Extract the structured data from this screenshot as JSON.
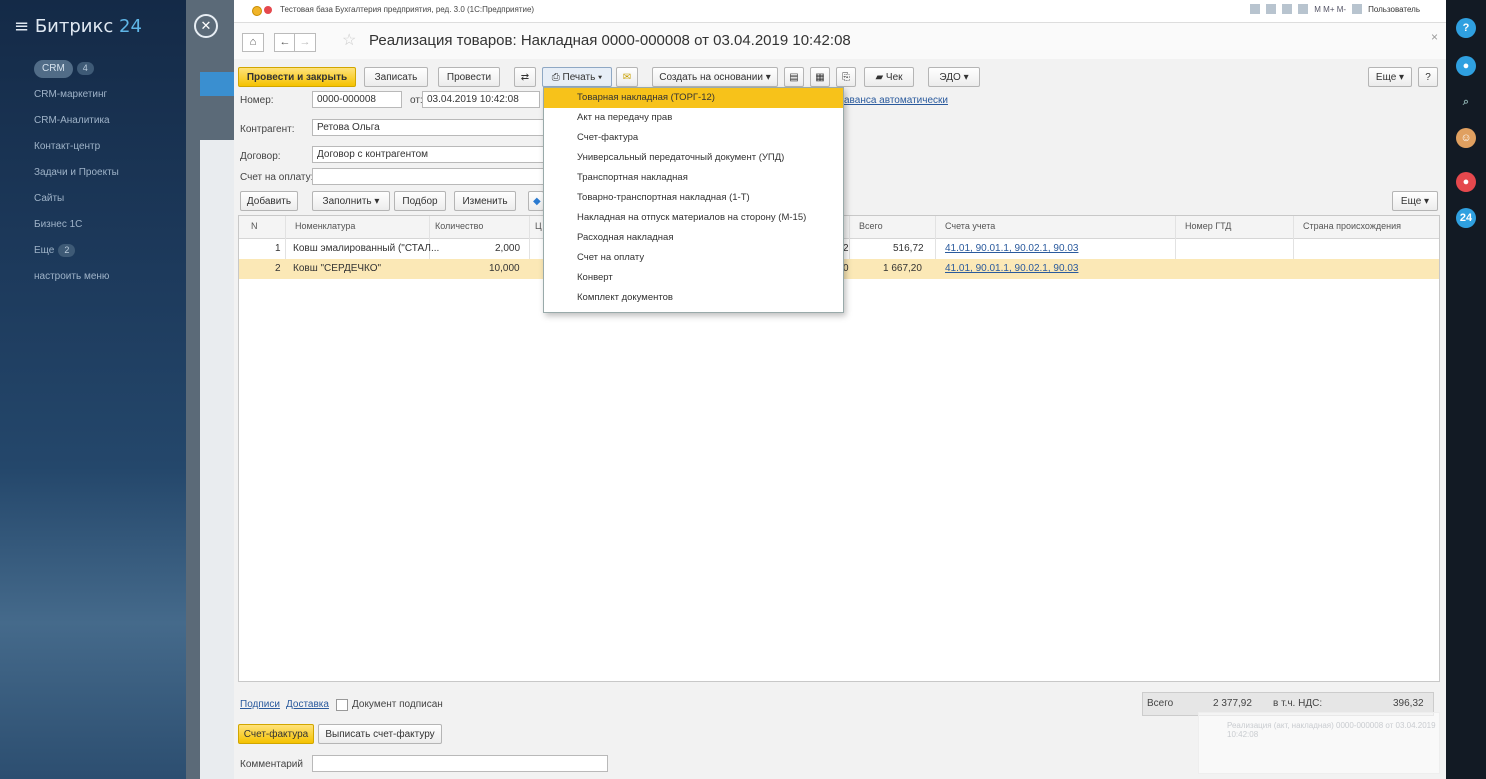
{
  "bitrix": {
    "logo_prefix": "Битрикс",
    "logo_num": "24",
    "nav": [
      {
        "label": "CRM",
        "badge": "4"
      },
      {
        "label": "CRM-маркетинг"
      },
      {
        "label": "CRM-Аналитика"
      },
      {
        "label": "Контакт-центр"
      },
      {
        "label": "Задачи и Проекты"
      },
      {
        "label": "Сайты"
      },
      {
        "label": "Бизнес 1С"
      },
      {
        "label": "Еще",
        "badge": "2"
      },
      {
        "label": "настроить меню"
      }
    ],
    "right_badges": [
      "?",
      "24"
    ]
  },
  "window": {
    "app_title": "Тестовая база Бухгалтерия предприятия, ред. 3.0  (1С:Предприятие)",
    "tools_user": "Пользователь",
    "doc_title": "Реализация товаров: Накладная 0000-000008 от 03.04.2019 10:42:08"
  },
  "toolbar": {
    "post_close": "Провести и закрыть",
    "save": "Записать",
    "post": "Провести",
    "print": "Печать",
    "create_based": "Создать на основании",
    "check": "Чек",
    "edo": "ЭДО",
    "more": "Еще",
    "help": "?"
  },
  "form": {
    "number_label": "Номер:",
    "number_value": "0000-000008",
    "date_label": "от:",
    "date_value": "03.04.2019 10:42:08",
    "counterparty_label": "Контрагент:",
    "counterparty_value": "Ретова Ольга",
    "contract_label": "Договор:",
    "contract_value": "Договор с контрагентом",
    "invoice_label": "Счет на оплату:",
    "advance_link": "аванса автоматически"
  },
  "table_toolbar": {
    "add": "Добавить",
    "fill": "Заполнить",
    "select": "Подбор",
    "change": "Изменить",
    "more": "Еще"
  },
  "table": {
    "headers": [
      "N",
      "Номенклатура",
      "Количество",
      "Ц",
      "Всего",
      "Счета учета",
      "Номер ГТД",
      "Страна происхождения"
    ],
    "rows": [
      {
        "n": "1",
        "name": "Ковш эмалированный (\"СТАЛ...",
        "qty": "2,000",
        "price_tail": "2",
        "total": "516,72",
        "accounts": "41.01, 90.01.1, 90.02.1, 90.03"
      },
      {
        "n": "2",
        "name": "Ковш \"СЕРДЕЧКО\"",
        "qty": "10,000",
        "price_tail": "0",
        "total": "1 667,20",
        "accounts": "41.01, 90.01.1, 90.02.1, 90.03"
      }
    ]
  },
  "print_menu": {
    "items": [
      "Товарная накладная (ТОРГ-12)",
      "Акт на передачу прав",
      "Счет-фактура",
      "Универсальный передаточный документ (УПД)",
      "Транспортная накладная",
      "Товарно-транспортная накладная (1-Т)",
      "Накладная на отпуск материалов на сторону (М-15)",
      "Расходная накладная",
      "Счет на оплату",
      "Конверт",
      "Комплект документов"
    ],
    "highlighted_index": 0
  },
  "footer": {
    "signatures_link": "Подписи",
    "delivery_link": "Доставка",
    "signed_label": "Документ подписан",
    "total_label": "Всего",
    "total_value": "2 377,92",
    "vat_label": "в т.ч. НДС:",
    "vat_value": "396,32",
    "invoice_tab": "Счет-фактура",
    "issue_invoice": "Выписать счет-фактуру",
    "comment_label": "Комментарий"
  },
  "notification": {
    "text": "Реализация (акт, накладная) 0000-000008 от 03.04.2019 10:42:08"
  },
  "colors": {
    "primary_button": "#f5c200",
    "menu_highlight": "#f7c21a",
    "selected_row": "#fbe8b6",
    "link": "#2a5a9d"
  }
}
